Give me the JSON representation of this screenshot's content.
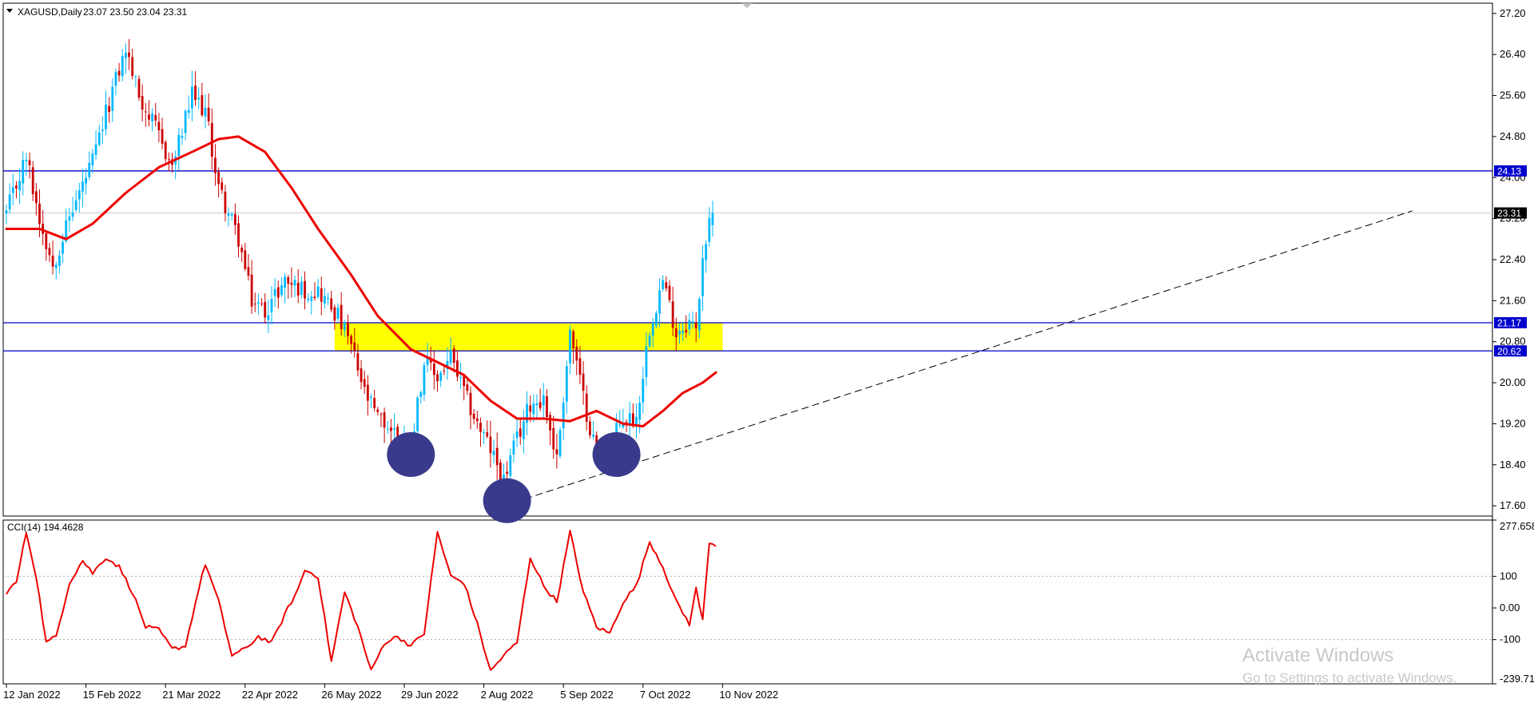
{
  "header": {
    "symbol": "XAGUSD,Daily",
    "ohlc": "23.07 23.50 23.04 23.31"
  },
  "colors": {
    "bull": "#00b8ff",
    "bear": "#cc0000",
    "ma": "#ee0000",
    "level": "#0000cc",
    "zone": "#ffff00",
    "circle": "#3a3a8c",
    "cci": "#ee0000",
    "current": "#000000"
  },
  "indicator": {
    "label": "CCI(14) 194.4628"
  },
  "watermark": {
    "line1": "Activate Windows",
    "line2": "Go to Settings to activate Windows."
  },
  "chart_data": [
    {
      "type": "candlestick",
      "ylim": [
        17.4,
        27.4
      ],
      "y_ticks": [
        "27.20",
        "26.40",
        "25.60",
        "24.80",
        "24.00",
        "23.20",
        "22.40",
        "21.60",
        "20.80",
        "20.00",
        "19.20",
        "18.40",
        "17.60"
      ],
      "x_tick_labels": [
        "12 Jan 2022",
        "15 Feb 2022",
        "21 Mar 2022",
        "22 Apr 2022",
        "26 May 2022",
        "29 Jun 2022",
        "2 Aug 2022",
        "5 Sep 2022",
        "7 Oct 2022",
        "10 Nov 2022"
      ],
      "anchors": [
        {
          "bar": 0,
          "close": 23.3
        },
        {
          "bar": 6,
          "close": 24.4
        },
        {
          "bar": 10,
          "close": 23.2
        },
        {
          "bar": 14,
          "close": 22.3
        },
        {
          "bar": 20,
          "close": 23.4
        },
        {
          "bar": 26,
          "close": 24.3
        },
        {
          "bar": 32,
          "close": 25.7
        },
        {
          "bar": 36,
          "close": 26.5
        },
        {
          "bar": 40,
          "close": 25.6
        },
        {
          "bar": 46,
          "close": 24.8
        },
        {
          "bar": 50,
          "close": 24.2
        },
        {
          "bar": 56,
          "close": 25.6
        },
        {
          "bar": 60,
          "close": 25.3
        },
        {
          "bar": 64,
          "close": 23.8
        },
        {
          "bar": 70,
          "close": 22.8
        },
        {
          "bar": 74,
          "close": 21.6
        },
        {
          "bar": 78,
          "close": 21.4
        },
        {
          "bar": 84,
          "close": 22.0
        },
        {
          "bar": 90,
          "close": 21.8
        },
        {
          "bar": 94,
          "close": 21.8
        },
        {
          "bar": 100,
          "close": 21.3
        },
        {
          "bar": 104,
          "close": 20.7
        },
        {
          "bar": 108,
          "close": 19.8
        },
        {
          "bar": 112,
          "close": 19.3
        },
        {
          "bar": 118,
          "close": 19.0
        },
        {
          "bar": 122,
          "close": 18.8
        },
        {
          "bar": 126,
          "close": 20.4
        },
        {
          "bar": 130,
          "close": 20.1
        },
        {
          "bar": 134,
          "close": 20.5
        },
        {
          "bar": 138,
          "close": 19.8
        },
        {
          "bar": 142,
          "close": 19.2
        },
        {
          "bar": 146,
          "close": 18.7
        },
        {
          "bar": 150,
          "close": 18.1
        },
        {
          "bar": 154,
          "close": 18.9
        },
        {
          "bar": 158,
          "close": 19.6
        },
        {
          "bar": 162,
          "close": 19.7
        },
        {
          "bar": 166,
          "close": 18.5
        },
        {
          "bar": 170,
          "close": 21.0
        },
        {
          "bar": 174,
          "close": 19.7
        },
        {
          "bar": 178,
          "close": 18.6
        },
        {
          "bar": 182,
          "close": 18.8
        },
        {
          "bar": 186,
          "close": 19.3
        },
        {
          "bar": 190,
          "close": 19.3
        },
        {
          "bar": 194,
          "close": 21.1
        },
        {
          "bar": 198,
          "close": 22.0
        },
        {
          "bar": 202,
          "close": 21.0
        },
        {
          "bar": 206,
          "close": 21.2
        },
        {
          "bar": 208,
          "close": 21.0
        },
        {
          "bar": 210,
          "close": 22.5
        },
        {
          "bar": 213,
          "close": 23.31
        }
      ],
      "horizontal_levels": [
        {
          "value": 24.13,
          "label": "24.13"
        },
        {
          "value": 21.17,
          "label": "21.17"
        },
        {
          "value": 20.62,
          "label": "20.62"
        }
      ],
      "current_price": {
        "value": 23.31,
        "label": "23.31"
      },
      "zone": {
        "y_low": 20.62,
        "y_high": 21.17,
        "bar_start": 99,
        "bar_end": 216
      },
      "moving_average": [
        {
          "bar": 0,
          "value": 23.0
        },
        {
          "bar": 10,
          "value": 23.0
        },
        {
          "bar": 18,
          "value": 22.8
        },
        {
          "bar": 26,
          "value": 23.1
        },
        {
          "bar": 36,
          "value": 23.7
        },
        {
          "bar": 46,
          "value": 24.2
        },
        {
          "bar": 56,
          "value": 24.5
        },
        {
          "bar": 64,
          "value": 24.75
        },
        {
          "bar": 70,
          "value": 24.8
        },
        {
          "bar": 78,
          "value": 24.5
        },
        {
          "bar": 86,
          "value": 23.8
        },
        {
          "bar": 94,
          "value": 23.0
        },
        {
          "bar": 104,
          "value": 22.1
        },
        {
          "bar": 112,
          "value": 21.3
        },
        {
          "bar": 122,
          "value": 20.65
        },
        {
          "bar": 130,
          "value": 20.4
        },
        {
          "bar": 138,
          "value": 20.15
        },
        {
          "bar": 146,
          "value": 19.65
        },
        {
          "bar": 154,
          "value": 19.3
        },
        {
          "bar": 162,
          "value": 19.3
        },
        {
          "bar": 170,
          "value": 19.25
        },
        {
          "bar": 178,
          "value": 19.45
        },
        {
          "bar": 186,
          "value": 19.2
        },
        {
          "bar": 192,
          "value": 19.15
        },
        {
          "bar": 198,
          "value": 19.45
        },
        {
          "bar": 204,
          "value": 19.8
        },
        {
          "bar": 210,
          "value": 20.0
        },
        {
          "bar": 214,
          "value": 20.2
        }
      ],
      "trendline": {
        "bar1": 150,
        "y1": 17.6,
        "bar2": 424,
        "y2": 23.35
      },
      "pattern_circles": [
        {
          "bar": 122,
          "value": 18.6
        },
        {
          "bar": 151,
          "value": 17.7
        },
        {
          "bar": 184,
          "value": 18.6
        }
      ]
    },
    {
      "type": "line",
      "title": "CCI(14) 194.4628",
      "ylim": [
        -239.714,
        277.658
      ],
      "y_ticks": [
        "277.658",
        "100",
        "0.00",
        "-100",
        "-239.714"
      ],
      "dotted_levels": [
        100,
        -100
      ],
      "anchors": [
        {
          "bar": 0,
          "value": 50
        },
        {
          "bar": 3,
          "value": 80
        },
        {
          "bar": 6,
          "value": 240
        },
        {
          "bar": 9,
          "value": 100
        },
        {
          "bar": 12,
          "value": -110
        },
        {
          "bar": 15,
          "value": -90
        },
        {
          "bar": 19,
          "value": 80
        },
        {
          "bar": 23,
          "value": 150
        },
        {
          "bar": 26,
          "value": 110
        },
        {
          "bar": 30,
          "value": 160
        },
        {
          "bar": 34,
          "value": 130
        },
        {
          "bar": 38,
          "value": 50
        },
        {
          "bar": 42,
          "value": -60
        },
        {
          "bar": 46,
          "value": -70
        },
        {
          "bar": 50,
          "value": -130
        },
        {
          "bar": 54,
          "value": -120
        },
        {
          "bar": 58,
          "value": 60
        },
        {
          "bar": 60,
          "value": 140
        },
        {
          "bar": 64,
          "value": 20
        },
        {
          "bar": 68,
          "value": -150
        },
        {
          "bar": 72,
          "value": -130
        },
        {
          "bar": 76,
          "value": -90
        },
        {
          "bar": 80,
          "value": -110
        },
        {
          "bar": 84,
          "value": -20
        },
        {
          "bar": 88,
          "value": 60
        },
        {
          "bar": 90,
          "value": 120
        },
        {
          "bar": 94,
          "value": 100
        },
        {
          "bar": 98,
          "value": -170
        },
        {
          "bar": 102,
          "value": 50
        },
        {
          "bar": 106,
          "value": -60
        },
        {
          "bar": 110,
          "value": -200
        },
        {
          "bar": 114,
          "value": -110
        },
        {
          "bar": 118,
          "value": -90
        },
        {
          "bar": 122,
          "value": -120
        },
        {
          "bar": 126,
          "value": -80
        },
        {
          "bar": 130,
          "value": 240
        },
        {
          "bar": 134,
          "value": 100
        },
        {
          "bar": 138,
          "value": 80
        },
        {
          "bar": 142,
          "value": -50
        },
        {
          "bar": 146,
          "value": -200
        },
        {
          "bar": 150,
          "value": -150
        },
        {
          "bar": 154,
          "value": -110
        },
        {
          "bar": 158,
          "value": 160
        },
        {
          "bar": 162,
          "value": 70
        },
        {
          "bar": 166,
          "value": 20
        },
        {
          "bar": 170,
          "value": 240
        },
        {
          "bar": 174,
          "value": 50
        },
        {
          "bar": 178,
          "value": -60
        },
        {
          "bar": 182,
          "value": -80
        },
        {
          "bar": 186,
          "value": 20
        },
        {
          "bar": 190,
          "value": 70
        },
        {
          "bar": 194,
          "value": 210
        },
        {
          "bar": 198,
          "value": 130
        },
        {
          "bar": 202,
          "value": 20
        },
        {
          "bar": 206,
          "value": -50
        },
        {
          "bar": 208,
          "value": 60
        },
        {
          "bar": 210,
          "value": -40
        },
        {
          "bar": 212,
          "value": 210
        },
        {
          "bar": 214,
          "value": 194.46
        }
      ]
    }
  ]
}
